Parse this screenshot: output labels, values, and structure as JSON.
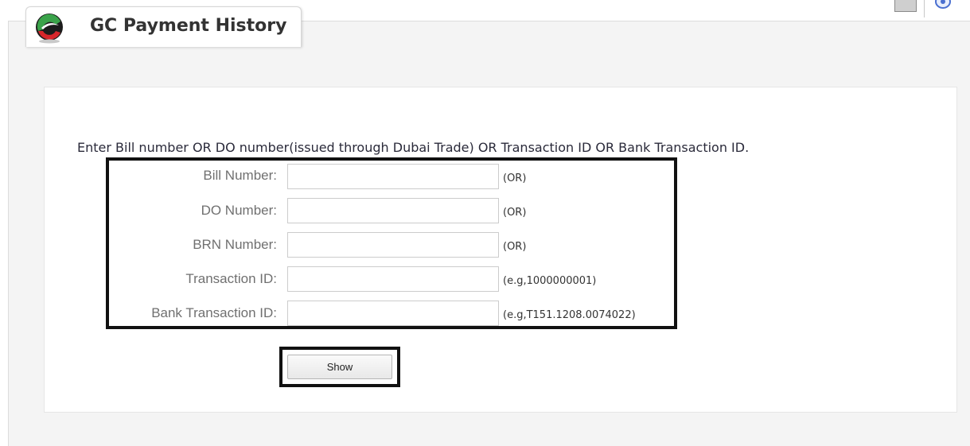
{
  "header": {
    "title": "GC Payment History",
    "icons": [
      "logo-icon",
      "print-icon",
      "view-icon"
    ]
  },
  "form": {
    "instruction": "Enter Bill number OR DO number(issued through Dubai Trade) OR Transaction ID OR Bank Transaction ID.",
    "fields": [
      {
        "label": "Bill Number:",
        "value": "",
        "hint": "(OR)"
      },
      {
        "label": "DO Number:",
        "value": "",
        "hint": "(OR)"
      },
      {
        "label": "BRN Number:",
        "value": "",
        "hint": "(OR)"
      },
      {
        "label": "Transaction ID:",
        "value": "",
        "hint": "(e.g,1000000001)"
      },
      {
        "label": "Bank Transaction ID:",
        "value": "",
        "hint": "(e.g,T151.1208.0074022)"
      }
    ],
    "show_label": "Show"
  },
  "colors": {
    "highlight_border": "#111111",
    "label_text": "#707070",
    "title_text": "#333333"
  }
}
